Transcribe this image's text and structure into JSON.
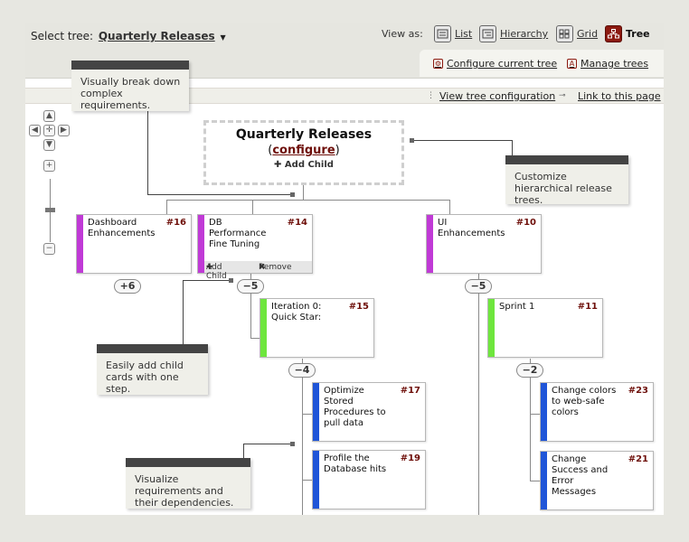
{
  "header": {
    "select_label": "Select tree:",
    "tree_name": "Quarterly Releases",
    "view_as_label": "View as:",
    "view_options": [
      {
        "label": "List",
        "icon": "list-icon"
      },
      {
        "label": "Hierarchy",
        "icon": "hierarchy-icon"
      },
      {
        "label": "Grid",
        "icon": "grid-icon"
      },
      {
        "label": "Tree",
        "icon": "tree-icon",
        "active": true
      }
    ],
    "configure_current_tree": "Configure current tree",
    "manage_trees": "Manage trees",
    "view_tree_configuration": "View tree configuration",
    "link_to_page": "Link to this page"
  },
  "root": {
    "title": "Quarterly Releases",
    "configure_open": "(",
    "configure_label": "configure",
    "configure_close": ")",
    "add_child": "Add Child"
  },
  "cards": {
    "c16": {
      "title": "Dashboard Enhancements",
      "num": "#16",
      "stripe": "#c03ad6"
    },
    "c14": {
      "title": "DB Performance Fine Tuning",
      "num": "#14",
      "stripe": "#c03ad6",
      "add_child": "Add Child",
      "remove": "Remove"
    },
    "c10": {
      "title": "UI Enhancements",
      "num": "#10",
      "stripe": "#c03ad6"
    },
    "c15": {
      "title": "Iteration 0: Quick Star:",
      "num": "#15",
      "stripe": "#6ee63d"
    },
    "c11": {
      "title": "Sprint 1",
      "num": "#11",
      "stripe": "#6ee63d"
    },
    "c17": {
      "title": "Optimize Stored Procedures to pull data",
      "num": "#17",
      "stripe": "#1f55d8"
    },
    "c19": {
      "title": "Profile the Database hits",
      "num": "#19",
      "stripe": "#1f55d8"
    },
    "c23": {
      "title": "Change colors to web-safe colors",
      "num": "#23",
      "stripe": "#1f55d8"
    },
    "c21": {
      "title": "Change Success and Error Messages",
      "num": "#21",
      "stripe": "#1f55d8"
    }
  },
  "toggles": {
    "t16": "+6",
    "t14": "−5",
    "t10": "−5",
    "t15": "−4",
    "t11": "−2"
  },
  "callouts": {
    "c1": "Visually break down complex requirements.",
    "c2": "Customize hierarchical release trees.",
    "c3": "Easily add child cards with one step.",
    "c4": "Visualize requirements and their dependencies."
  },
  "colors": {
    "accent": "#8c1a10",
    "epic": "#c03ad6",
    "sprint": "#6ee63d",
    "task": "#1f55d8"
  }
}
